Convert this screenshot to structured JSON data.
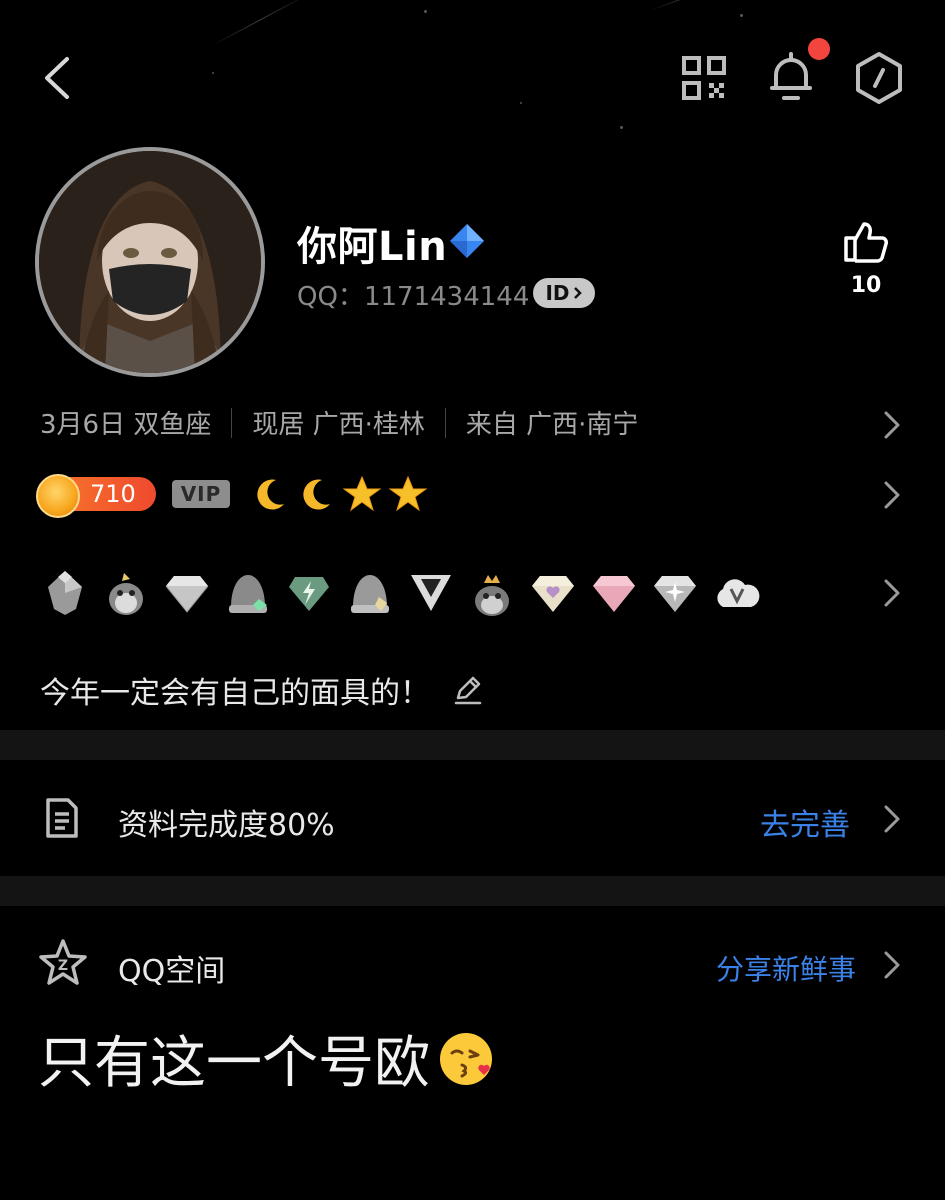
{
  "profile": {
    "nickname": "你阿Lin",
    "qq_label": "QQ：",
    "qq_number": "1171434144",
    "id_badge": "ID",
    "likes": "10"
  },
  "info": {
    "birthday": "3月6日 双鱼座",
    "residence": "现居 广西·桂林",
    "hometown": "来自 广西·南宁"
  },
  "level": {
    "points": "710",
    "vip": "VIP"
  },
  "signature": "今年一定会有自己的面具的！",
  "completion": {
    "label": "资料完成度80%",
    "action": "去完善"
  },
  "qzone": {
    "label": "QQ空间",
    "action": "分享新鲜事",
    "latest_post": "只有这一个号欧"
  },
  "icons": {
    "back": "back-arrow-icon",
    "qr": "qr-code-icon",
    "bell": "bell-icon",
    "settings": "hexagon-settings-icon",
    "like": "thumbs-up-icon",
    "edit": "pencil-icon",
    "document": "document-icon",
    "qzone": "star-icon"
  },
  "colors": {
    "accent": "#3b82e8",
    "notification": "#f2453d",
    "background": "#000000"
  }
}
